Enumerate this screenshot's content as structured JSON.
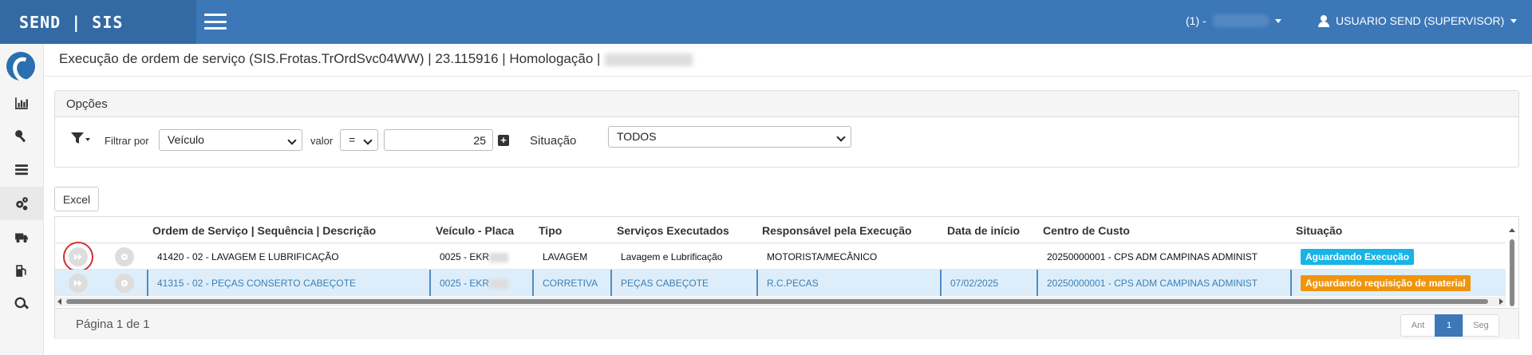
{
  "app": {
    "brand": "SEND | SIS"
  },
  "topbar": {
    "company_label": "(1) -",
    "user_label": "USUARIO SEND (SUPERVISOR)"
  },
  "sidebar": {
    "items": [
      {
        "icon": "bar-chart-icon"
      },
      {
        "icon": "key-icon"
      },
      {
        "icon": "list-icon"
      },
      {
        "icon": "gears-icon"
      },
      {
        "icon": "truck-icon"
      },
      {
        "icon": "gas-pump-icon"
      },
      {
        "icon": "search-icon"
      }
    ]
  },
  "page": {
    "title": "Execução de ordem de serviço (SIS.Frotas.TrOrdSvc04WW) | 23.115916 | Homologação |"
  },
  "options": {
    "heading": "Opções",
    "filter_by_label": "Filtrar por",
    "filter_by_value": "Veículo",
    "value_label": "valor",
    "operator_value": "=",
    "filter_value": "25",
    "plus_label": "+",
    "situation_label": "Situação",
    "situation_value": "TODOS"
  },
  "toolbar": {
    "excel_label": "Excel"
  },
  "grid": {
    "columns": [
      "Ordem de Serviço | Sequência | Descrição",
      "Veículo - Placa",
      "Tipo",
      "Serviços Executados",
      "Responsável pela Execução",
      "Data de início",
      "Centro de Custo",
      "Situação"
    ],
    "rows": [
      {
        "order": "41420 - 02 - LAVAGEM E LUBRIFICAÇÃO",
        "vehicle": "0025 - EKR",
        "type": "LAVAGEM",
        "services": "Lavagem e Lubrificação",
        "responsible": "MOTORISTA/MECÂNICO",
        "start_date": "",
        "cost_center": "20250000001 - CPS ADM CAMPINAS ADMINIST",
        "status": "Aguardando Execução",
        "status_color": "#17b4e6"
      },
      {
        "order": "41315 - 02 - PEÇAS CONSERTO CABEÇOTE",
        "vehicle": "0025 - EKR",
        "type": "CORRETIVA",
        "services": "PEÇAS CABEÇOTE",
        "responsible": "R.C.PECAS",
        "start_date": "07/02/2025",
        "cost_center": "20250000001 - CPS ADM CAMPINAS ADMINIST",
        "status": "Aguardando requisição de material",
        "status_color": "#f0940e"
      }
    ],
    "footer": {
      "page_info": "Página 1 de 1",
      "prev_label": "Ant",
      "current_page": "1",
      "next_label": "Seg"
    }
  },
  "colors": {
    "topbar": "#3c78b8",
    "brand_bg": "#336aa4",
    "selected_row": "#ddeefa"
  }
}
